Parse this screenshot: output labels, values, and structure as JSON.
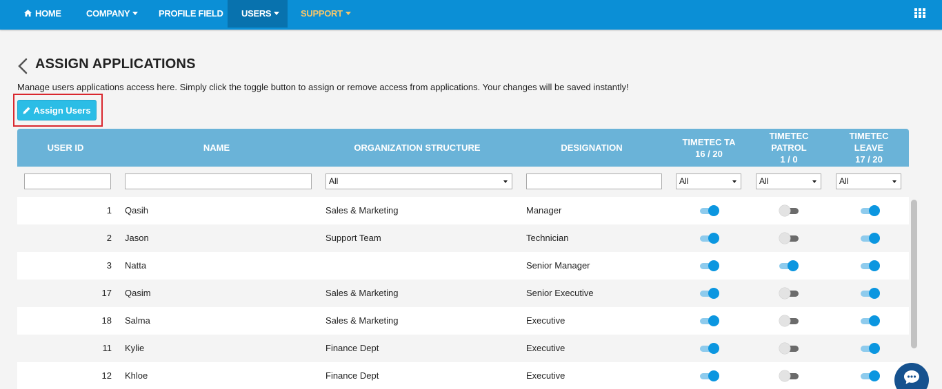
{
  "nav": {
    "home": "HOME",
    "company": "COMPANY",
    "profile_field": "PROFILE FIELD",
    "users": "USERS",
    "support": "SUPPORT",
    "apps_icon": "grid-icon"
  },
  "header": {
    "title": "ASSIGN APPLICATIONS",
    "description": "Manage users applications access here. Simply click the toggle button to assign or remove access from applications. Your changes will be saved instantly!",
    "assign_button": "Assign Users"
  },
  "table": {
    "columns": {
      "user_id": "USER ID",
      "name": "NAME",
      "org": "ORGANIZATION STRUCTURE",
      "designation": "DESIGNATION",
      "ta": "TIMETEC TA",
      "ta_count": "16 / 20",
      "patrol": "TIMETEC PATROL",
      "patrol_count": "1 / 0",
      "leave": "TIMETEC LEAVE",
      "leave_count": "17 / 20"
    },
    "filters": {
      "org": "All",
      "ta": "All",
      "patrol": "All",
      "leave": "All"
    },
    "rows": [
      {
        "id": "1",
        "name": "Qasih",
        "org": "Sales & Marketing",
        "designation": "Manager",
        "ta": true,
        "patrol": false,
        "leave": true
      },
      {
        "id": "2",
        "name": "Jason",
        "org": "Support Team",
        "designation": "Technician",
        "ta": true,
        "patrol": false,
        "leave": true
      },
      {
        "id": "3",
        "name": "Natta",
        "org": "",
        "designation": "Senior Manager",
        "ta": true,
        "patrol": true,
        "leave": true
      },
      {
        "id": "17",
        "name": "Qasim",
        "org": "Sales & Marketing",
        "designation": "Senior Executive",
        "ta": true,
        "patrol": false,
        "leave": true
      },
      {
        "id": "18",
        "name": "Salma",
        "org": "Sales & Marketing",
        "designation": "Executive",
        "ta": true,
        "patrol": false,
        "leave": true
      },
      {
        "id": "11",
        "name": "Kylie",
        "org": "Finance Dept",
        "designation": "Executive",
        "ta": true,
        "patrol": false,
        "leave": true
      },
      {
        "id": "12",
        "name": "Khloe",
        "org": "Finance Dept",
        "designation": "Executive",
        "ta": true,
        "patrol": false,
        "leave": true
      }
    ]
  },
  "colors": {
    "nav_bg": "#0b8fd6",
    "nav_active": "#0872ae",
    "support_text": "#f5c66b",
    "table_header": "#6ab3d8",
    "button": "#2bbde6",
    "toggle_on": "#0b96e0",
    "highlight": "#d9272e",
    "chat": "#16528f"
  }
}
